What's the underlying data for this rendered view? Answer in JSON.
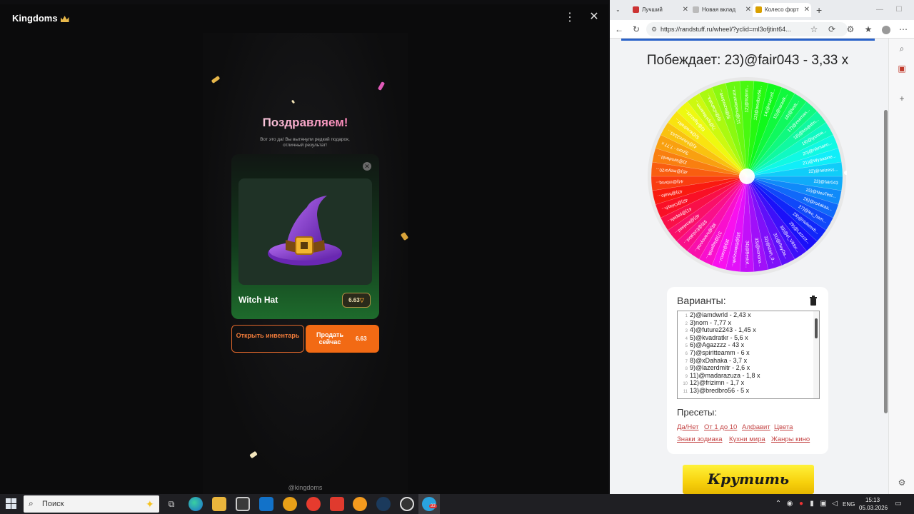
{
  "app": {
    "title": "Kingdoms",
    "title_icon": "crown-icon",
    "menu_glyph": "⋮",
    "close_glyph": "✕",
    "congrats_title": "Поздравляем!",
    "congrats_subtitle": "Вот это да! Вы вытянули редкий подарок, отличный результат!",
    "item": {
      "name": "Witch Hat",
      "price": "6.63",
      "image_icon": "witch-hat-icon"
    },
    "inventory_button": "Открыть инвентарь",
    "sell_button": "Продать сейчас",
    "sell_amount": "6.63",
    "footer_handle": "@kingdoms",
    "colors": {
      "accent": "#f26a14",
      "card_green": "#1e6b2c",
      "pink": "#ff5fa2"
    }
  },
  "browser": {
    "tabs": [
      {
        "label": "Лучший",
        "icon": "speaker-icon"
      },
      {
        "label": "Новая вклад",
        "icon": "newtab-icon"
      },
      {
        "label": "Колесо форт",
        "icon": "randstuff-icon",
        "active": true
      }
    ],
    "url": "https://randstuff.ru/wheel/?yclid=ml3ofjtint64...",
    "page": {
      "winner": "Побеждает: 23)@fair043 - 3,33 x",
      "wheel_labels": [
        "23)@fair043",
        "25)@NeoTest...",
        "26)@ro4akaa...",
        "27)@leo_ham...",
        "28)@Holotovb...",
        "29)@Lazzzz...",
        "30)@el_Viktor...",
        "31)@ReyDa...",
        "32)@shkh_0...",
        "33)@ironona...",
        "34)@Bestof...",
        "35)@Bakerzyak...",
        "36)@lvarcv...",
        "37)@lagerblk...",
        "38)@Ivanoyvod...",
        "39)@Ezdaklol...",
        "40)@koalasd...",
        "41)@papalv...",
        "42)@Orlayh...",
        "43)@hsalo...",
        "44)@mbvxq...",
        "45)@mayor20...",
        "2)@iamdwrld...",
        "3)nom - 7,77 x",
        "4)@future2243...",
        "5)@kvadratkr...",
        "6)@Agazzzz...",
        "7)@spiritteamm...",
        "8)@xDahaka...",
        "9)@lazerdmitr...",
        "11)@madarazuza...",
        "12)@frizimn...",
        "13)@bredbro56...",
        "14)@marcell...",
        "15)@tarasik...",
        "16)@lostt...",
        "17)@zeeman...",
        "18)@kniqlnfm...",
        "19)@iyunne...",
        "20)@nikmano...",
        "21)@Wyaaaine...",
        "22)@neizess..."
      ],
      "variants_title": "Варианты:",
      "variants": [
        "2)@iamdwrld - 2,43 x",
        "3)nom - 7,77 x",
        "4)@future2243 - 1,45 x",
        "5)@kvadratkr - 5,6 x",
        "6)@Agazzzz - 43 x",
        "7)@spiritteamm - 6 x",
        "8)@xDahaka - 3,7 x",
        "9)@lazerdmitr - 2,6 x",
        "11)@madarazuza - 1,8 x",
        "12)@frizimn - 1,7 x",
        "13)@bredbro56 - 5 x"
      ],
      "variant_line_numbers": [
        "1",
        "2",
        "3",
        "4",
        "5",
        "6",
        "7",
        "8",
        "9",
        "10",
        "11"
      ],
      "presets_title": "Пресеты:",
      "presets": [
        "Да/Нет",
        "От 1 до 10",
        "Алфавит",
        "Цвета",
        "Знаки зодиака",
        "Кухни мира",
        "Жанры кино"
      ],
      "spin_button": "Крутить"
    }
  },
  "taskbar": {
    "search_placeholder": "Поиск",
    "lang": "ENG",
    "time": "15:13",
    "date": "05.03.2026",
    "badge": "33"
  }
}
